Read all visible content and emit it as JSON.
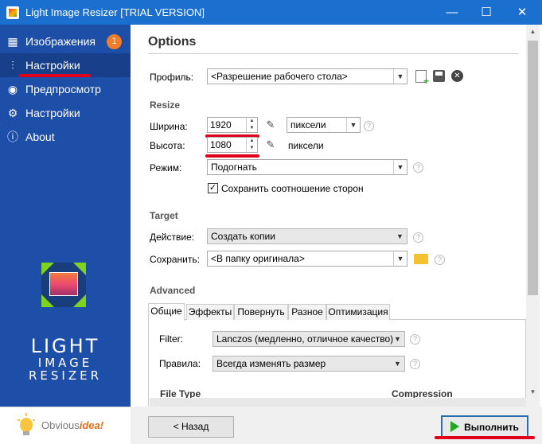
{
  "window": {
    "title": "Light Image Resizer  [TRIAL VERSION]",
    "minimize": "—",
    "maximize": "☐",
    "close": "✕"
  },
  "sidebar": {
    "items": [
      {
        "label": "Изображения",
        "icon": "images-icon",
        "badge": "1"
      },
      {
        "label": "Настройки",
        "icon": "sliders-icon",
        "active": true
      },
      {
        "label": "Предпросмотр",
        "icon": "eye-icon"
      },
      {
        "label": "Настройки",
        "icon": "gear-icon"
      },
      {
        "label": "About",
        "icon": "info-icon"
      }
    ],
    "logo": {
      "line1": "LIGHT",
      "line2": "IMAGE",
      "line3": "RESIZER"
    }
  },
  "options": {
    "heading": "Options",
    "profile": {
      "label": "Профиль:",
      "value": "<Разрешение рабочего стола>"
    },
    "resize": {
      "heading": "Resize",
      "width_label": "Ширина:",
      "width_value": "1920",
      "height_label": "Высота:",
      "height_value": "1080",
      "unit_value": "пиксели",
      "unit_text": "пиксели",
      "mode_label": "Режим:",
      "mode_value": "Подогнать",
      "keep_ratio_label": "Сохранить соотношение сторон",
      "keep_ratio_checked": true
    },
    "target": {
      "heading": "Target",
      "action_label": "Действие:",
      "action_value": "Создать копии",
      "save_label": "Сохранить:",
      "save_value": "<В папку оригинала>"
    },
    "advanced": {
      "heading": "Advanced",
      "tabs": [
        "Общие",
        "Эффекты",
        "Повернуть",
        "Разное",
        "Оптимизация"
      ],
      "filter_label": "Filter:",
      "filter_value": "Lanczos  (медленно, отличное качество)",
      "rules_label": "Правила:",
      "rules_value": "Всегда изменять размер",
      "filetype_label": "File Type",
      "compression_label": "Compression"
    }
  },
  "footer": {
    "brand_prefix": "Obvious",
    "brand_suffix": "idea!",
    "back_button": "< Назад",
    "run_button": "Выполнить"
  },
  "colors": {
    "titlebar": "#1a6fcf",
    "sidebar": "#1d4ea8",
    "sidebar_active": "#173f8a",
    "badge": "#f07d2b",
    "annotation_red": "#e0001b",
    "run_green": "#22a822"
  }
}
